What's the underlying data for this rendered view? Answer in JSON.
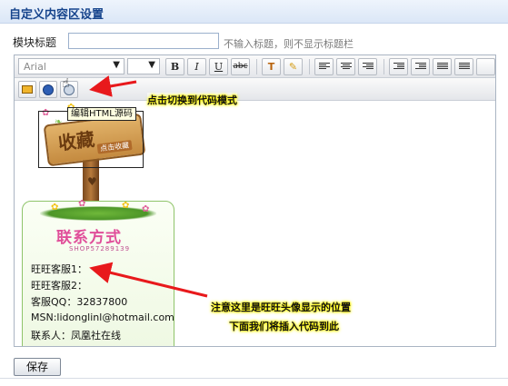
{
  "panel": {
    "title": "自定义内容区设置"
  },
  "title_row": {
    "label": "模块标题",
    "input_value": "",
    "hint": "不输入标题，则不显示标题栏"
  },
  "toolbar": {
    "font_family": "Arial",
    "font_size": "",
    "bold": "B",
    "italic": "I",
    "underline": "U",
    "strike": "abc"
  },
  "content": {
    "sign_text": "收藏",
    "sign_sub": "点击收藏",
    "contact_title": "联系方式",
    "shop_id": "SHOP57289139",
    "lines": [
      "旺旺客服1：",
      "旺旺客服2：",
      "客服QQ：32837800",
      "MSN:lidonglinl@hotmail.com",
      "联系人：凤凰社在线"
    ]
  },
  "tooltip": "编辑HTML源码",
  "annotations": {
    "switch_hint": "点击切换到代码模式",
    "note_line1": "注意这里是旺旺头像显示的位置",
    "note_line2": "下面我们将插入代码到此"
  },
  "save_button": "保存",
  "colors": {
    "header_title": "#16448c",
    "contact_title": "#e04f9a",
    "arrow": "#e8191c",
    "highlight": "#fff700"
  }
}
